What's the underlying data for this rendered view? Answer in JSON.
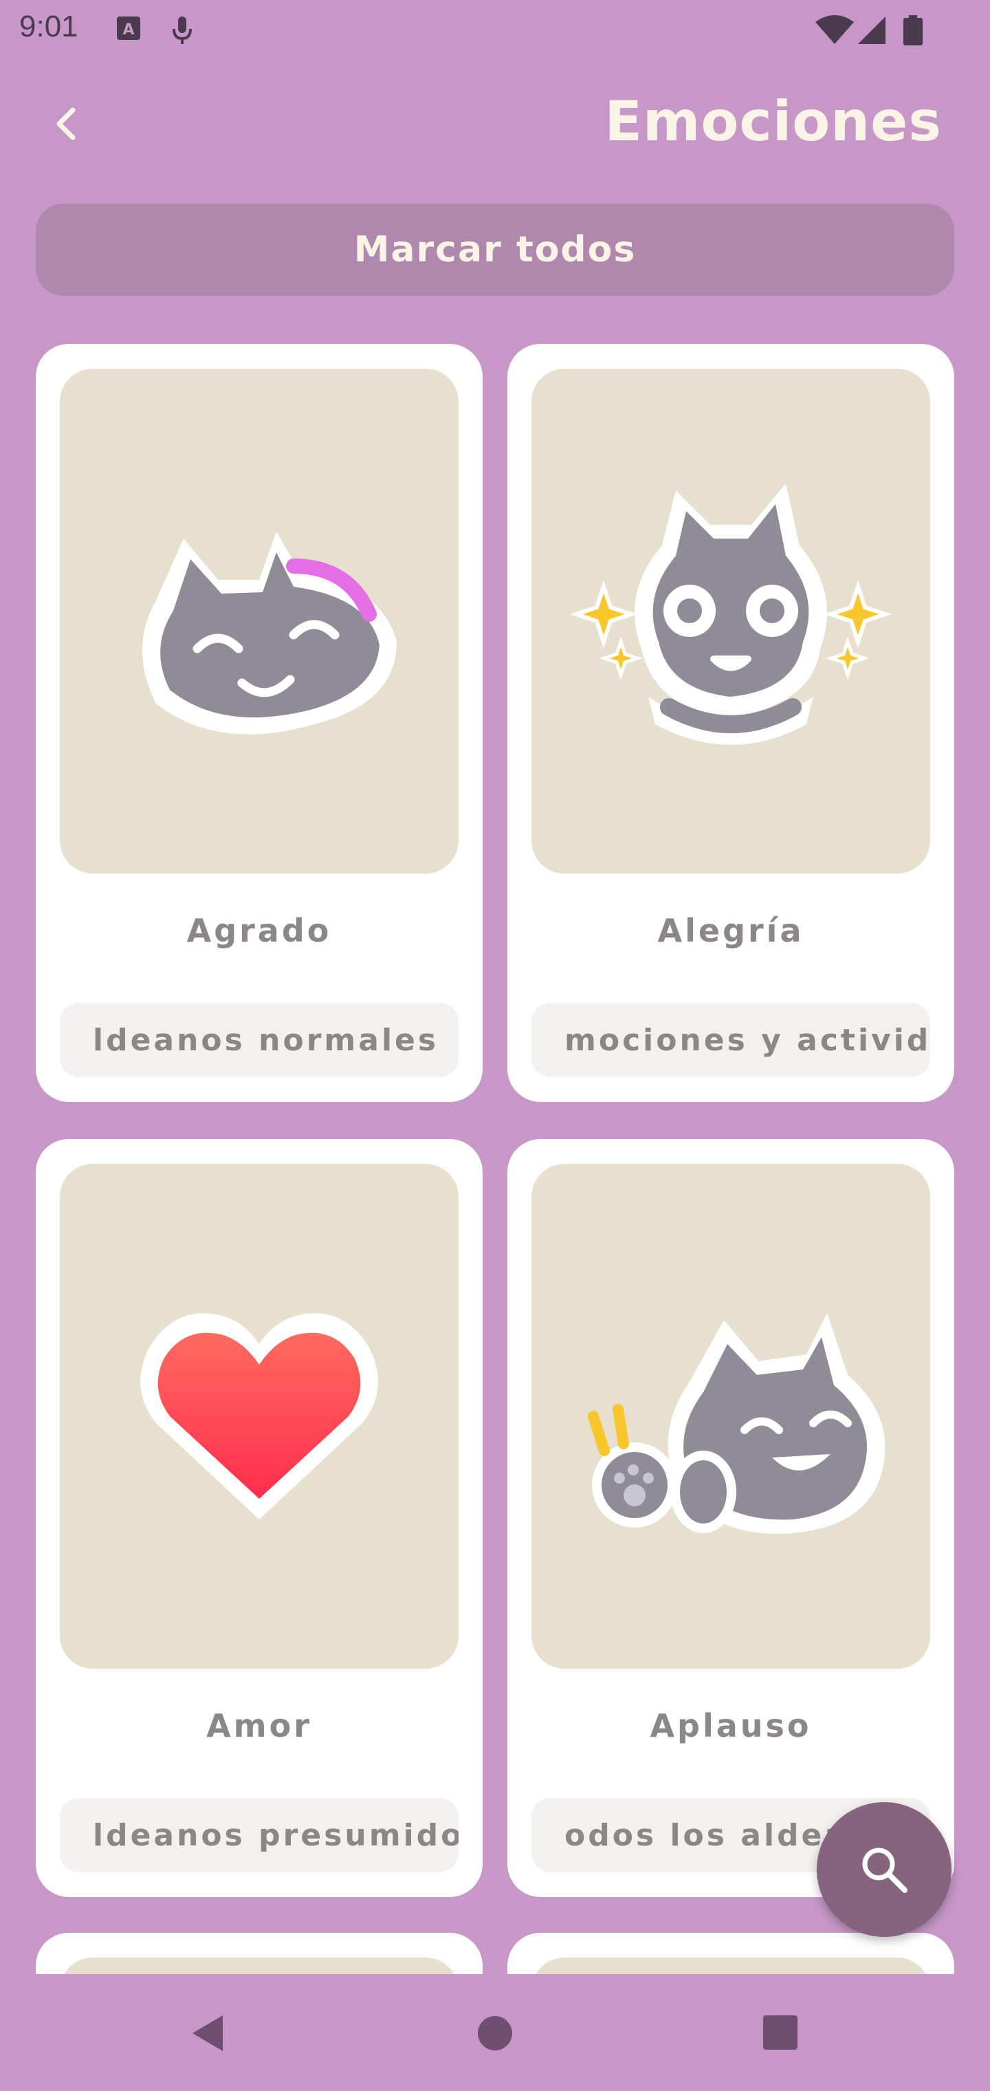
{
  "status_bar": {
    "time": "9:01"
  },
  "header": {
    "title": "Emociones",
    "mark_all_label": "Marcar todos"
  },
  "cards": [
    {
      "name": "Agrado",
      "tag": "ldeanos normales"
    },
    {
      "name": "Alegría",
      "tag": "mociones y activid"
    },
    {
      "name": "Amor",
      "tag": "ldeanos presumido"
    },
    {
      "name": "Aplauso",
      "tag": "odos los aldeanos"
    }
  ],
  "colors": {
    "background": "#c797c8",
    "card_image_bg": "#e8e0cf",
    "fab": "#86647e",
    "title_text": "#faf4e6"
  }
}
